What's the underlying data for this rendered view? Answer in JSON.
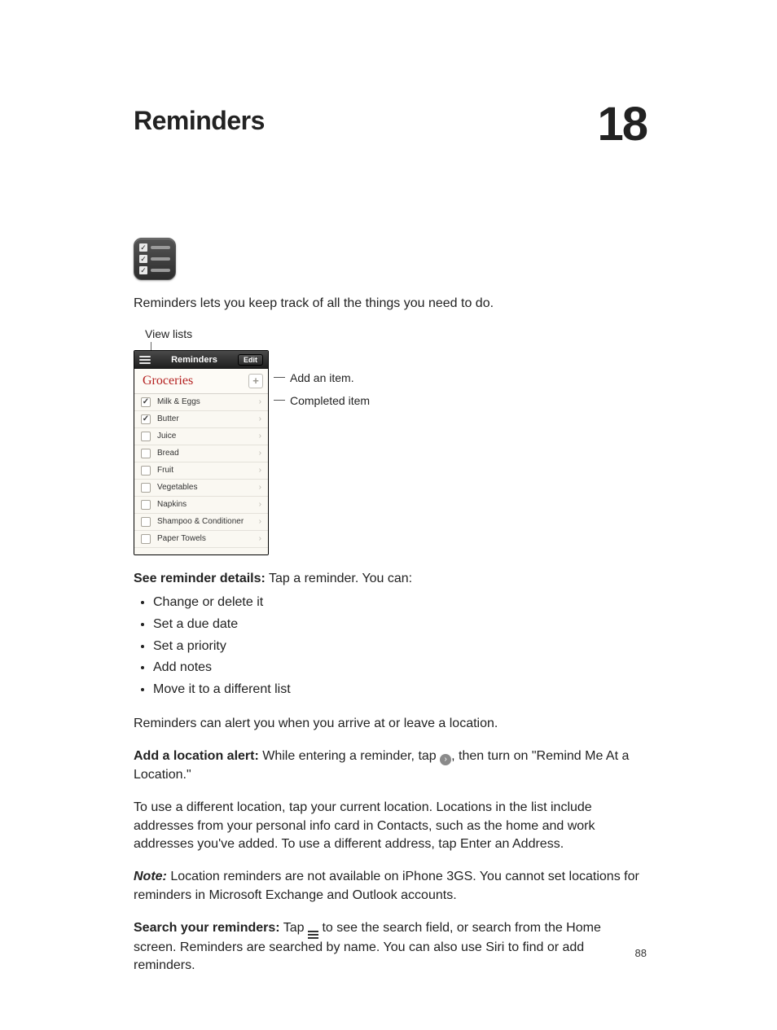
{
  "chapter": {
    "title": "Reminders",
    "number": "18"
  },
  "intro": "Reminders lets you keep track of all the things you need to do.",
  "figure": {
    "view_lists_label": "View lists",
    "header_title": "Reminders",
    "edit_label": "Edit",
    "list_title": "Groceries",
    "add_symbol": "+",
    "items": [
      {
        "label": "Milk & Eggs",
        "checked": true
      },
      {
        "label": "Butter",
        "checked": true
      },
      {
        "label": "Juice",
        "checked": false
      },
      {
        "label": "Bread",
        "checked": false
      },
      {
        "label": "Fruit",
        "checked": false
      },
      {
        "label": "Vegetables",
        "checked": false
      },
      {
        "label": "Napkins",
        "checked": false
      },
      {
        "label": "Shampoo & Conditioner",
        "checked": false
      },
      {
        "label": "Paper Towels",
        "checked": false
      }
    ],
    "callouts": {
      "add_item": "Add an item.",
      "completed_item": "Completed item"
    }
  },
  "details": {
    "lead_bold": "See reminder details:",
    "lead_rest": "  Tap a reminder. You can:",
    "bullets": [
      "Change or delete it",
      "Set a due date",
      "Set a priority",
      "Add notes",
      "Move it to a different list"
    ]
  },
  "location_intro": "Reminders can alert you when you arrive at or leave a location.",
  "location_alert": {
    "lead_bold": "Add a location alert:",
    "part1": "  While entering a reminder, tap ",
    "part2": ", then turn on \"Remind Me At a Location.\""
  },
  "location_use": "To use a different location, tap your current location. Locations in the list include addresses from your personal info card in Contacts, such as the home and work addresses you've added. To use a different address, tap Enter an Address.",
  "note": {
    "label": "Note:",
    "text": "  Location reminders are not available on iPhone 3GS. You cannot set locations for reminders in Microsoft Exchange and Outlook accounts."
  },
  "search": {
    "lead_bold": "Search your reminders:",
    "part1": "  Tap ",
    "part2": " to see the search field, or search from the Home screen. Reminders are searched by name. You can also use Siri to find or add reminders."
  },
  "page_number": "88"
}
